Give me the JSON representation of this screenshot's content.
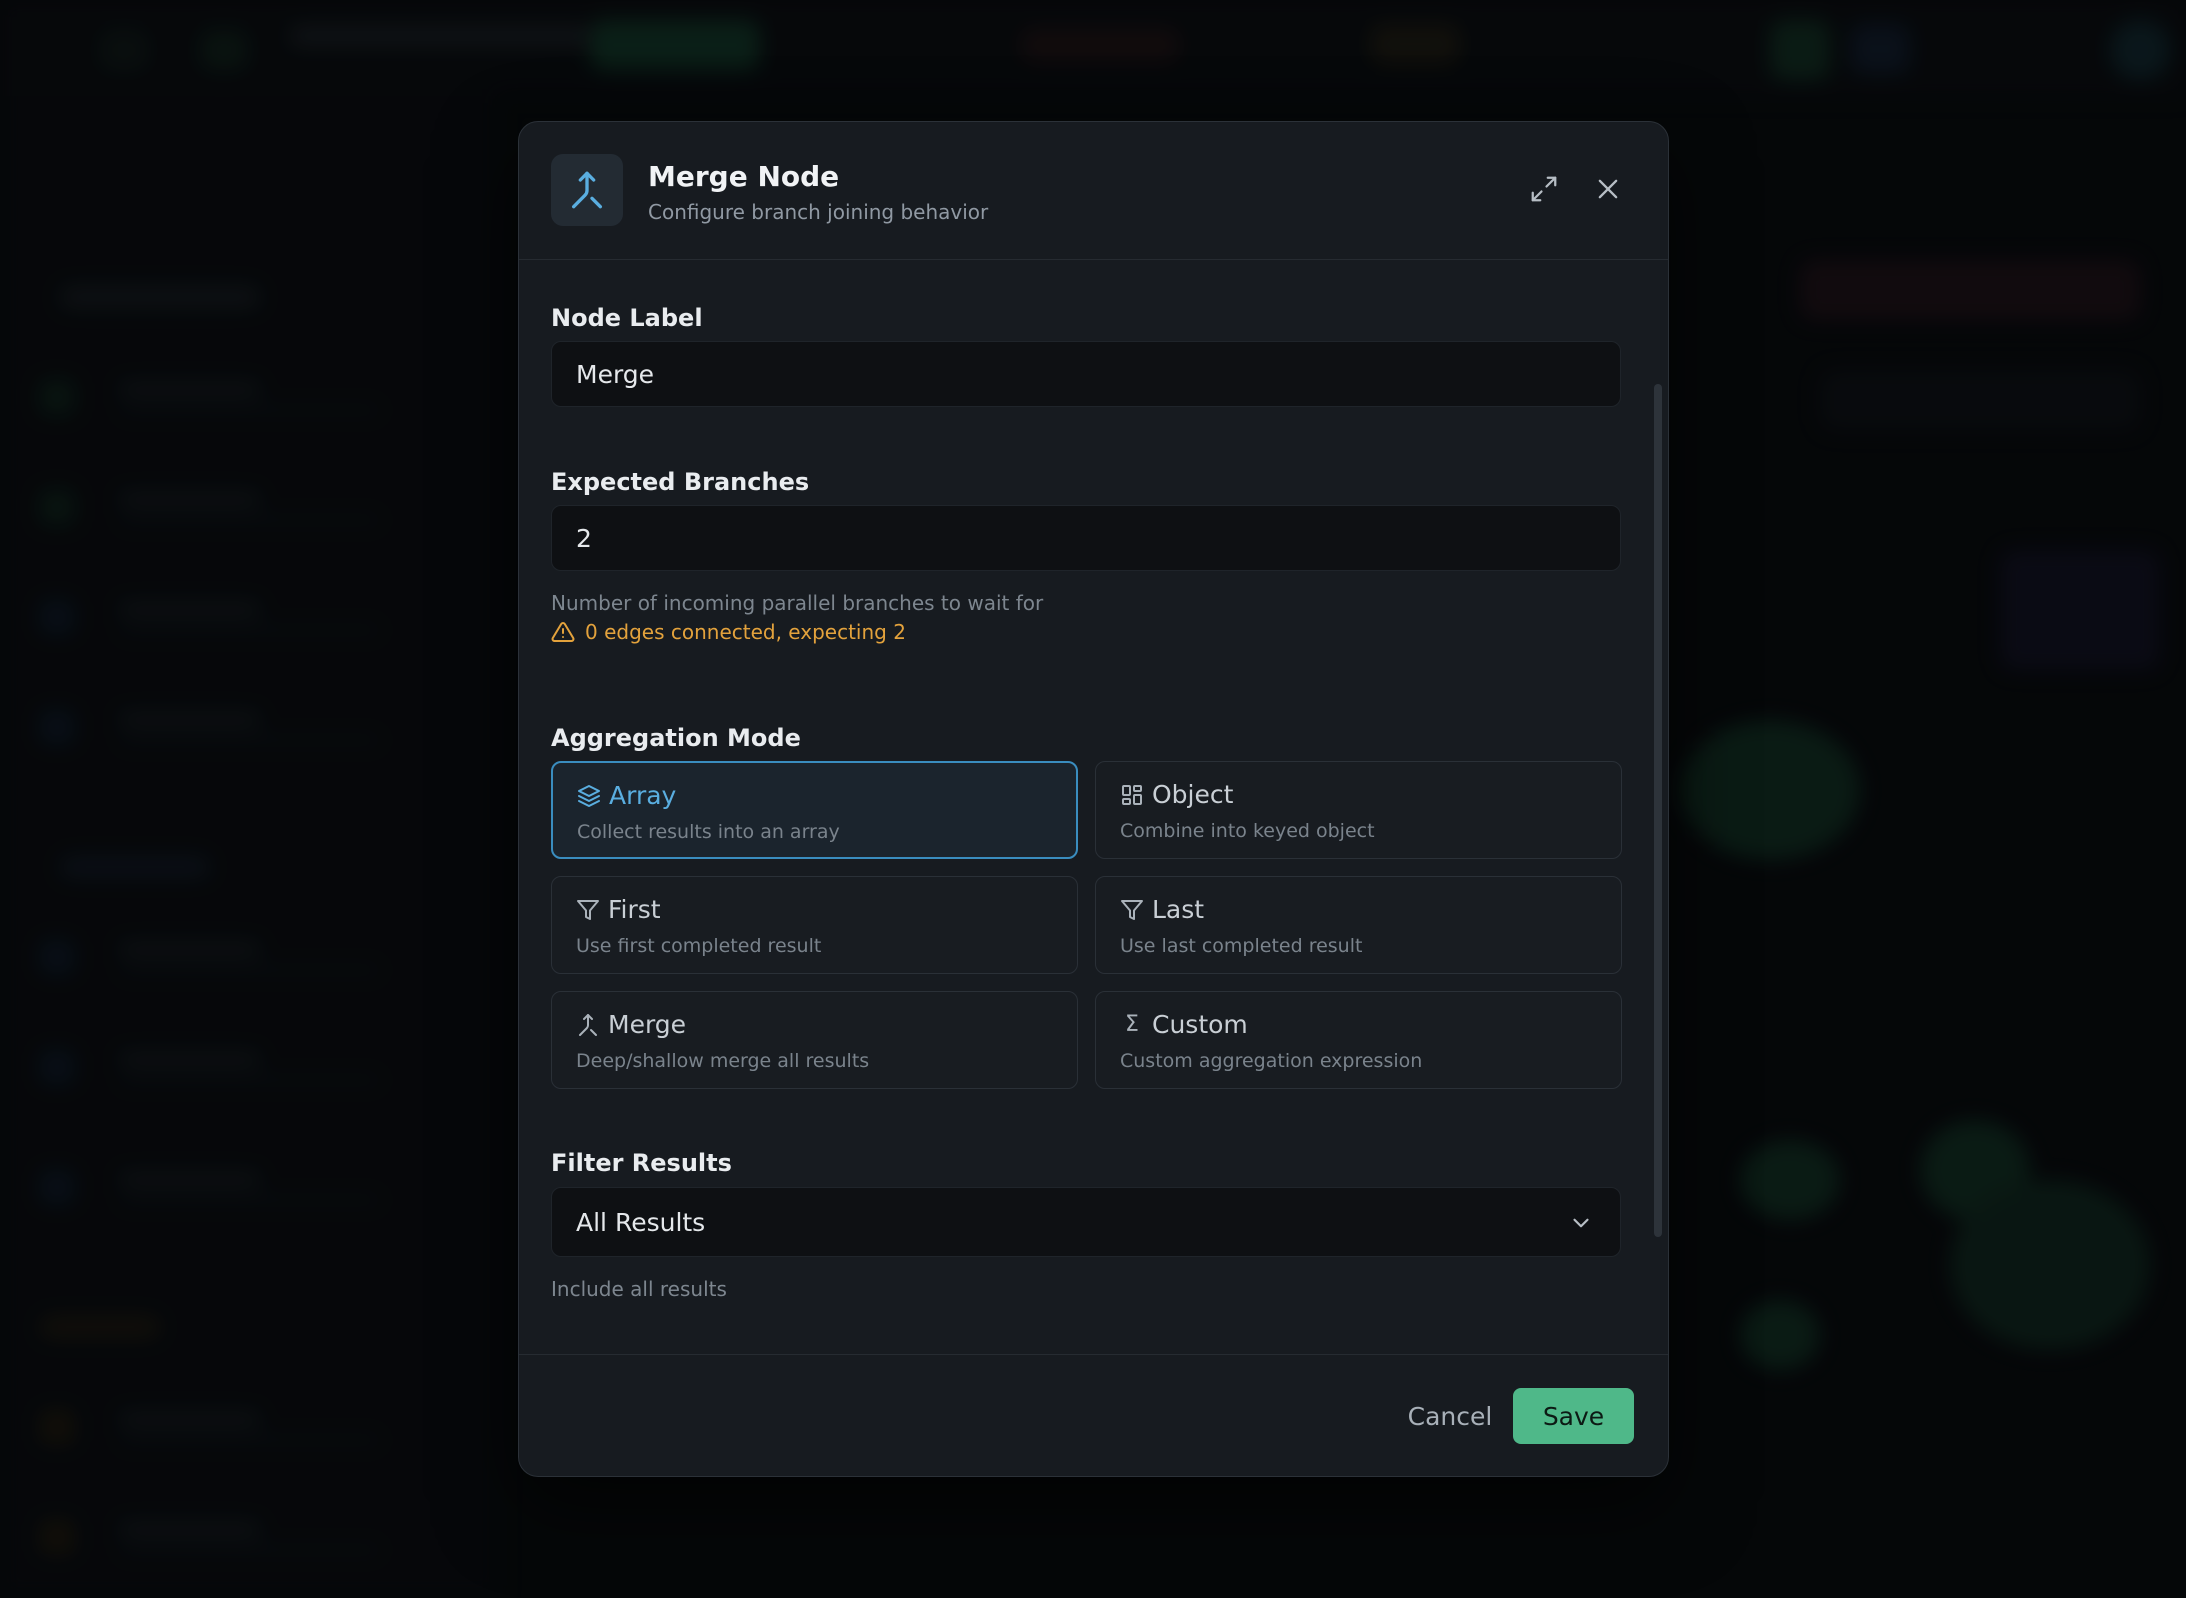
{
  "modal": {
    "title": "Merge Node",
    "subtitle": "Configure branch joining behavior",
    "icon": "merge-icon",
    "actions": {
      "expand_icon": "expand-icon",
      "close_icon": "close-icon"
    }
  },
  "fields": {
    "node_label": {
      "label": "Node Label",
      "value": "Merge"
    },
    "expected_branches": {
      "label": "Expected Branches",
      "value": "2",
      "hint": "Number of incoming parallel branches to wait for",
      "warning": "0 edges connected, expecting 2"
    },
    "aggregation_mode": {
      "label": "Aggregation Mode",
      "selected": "Array",
      "options": [
        {
          "title": "Array",
          "description": "Collect results into an array",
          "icon": "layers-icon"
        },
        {
          "title": "Object",
          "description": "Combine into keyed object",
          "icon": "grid-icon"
        },
        {
          "title": "First",
          "description": "Use first completed result",
          "icon": "filter-icon"
        },
        {
          "title": "Last",
          "description": "Use last completed result",
          "icon": "filter-icon"
        },
        {
          "title": "Merge",
          "description": "Deep/shallow merge all results",
          "icon": "merge-icon"
        },
        {
          "title": "Custom",
          "description": "Custom aggregation expression",
          "icon": "sigma-icon"
        }
      ]
    },
    "filter_results": {
      "label": "Filter Results",
      "value": "All Results",
      "hint": "Include all results"
    }
  },
  "footer": {
    "cancel_label": "Cancel",
    "save_label": "Save"
  },
  "colors": {
    "accent": "#5aaee0",
    "save": "#4fb889",
    "warning": "#e3a23c",
    "modal_bg": "#171b20",
    "input_bg": "#0e1013"
  }
}
